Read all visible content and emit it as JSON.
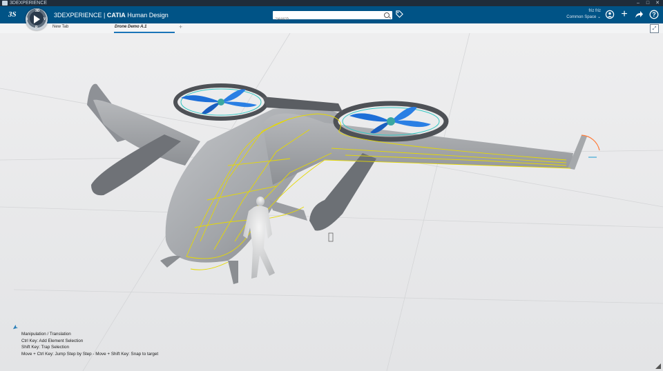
{
  "window": {
    "title": "3DEXPERIENCE"
  },
  "topbar": {
    "brand_prefix": "3DEXPERIENCE | ",
    "brand_app": "CATIA",
    "brand_suffix": " Human Design",
    "search_placeholder": "Search",
    "user_name": "friz friz",
    "space_label": "Common Space"
  },
  "tabs": [
    {
      "label": "New Tab"
    },
    {
      "label": "Drone Demo A.1"
    }
  ],
  "add_tab": "+",
  "hud": {
    "lines": [
      "Manipulation / Translation",
      "Ctrl Key: Add Element Selection",
      "Shift Key: Trap Selection",
      "Move + Ctrl Key: Jump Step by Step - Move + Shift Key: Snap to target"
    ]
  },
  "colors": {
    "topbar": "#005386",
    "highlight": "#e6d900",
    "rotor_blue": "#1e6fd8",
    "body_gray": "#a9acb0"
  }
}
